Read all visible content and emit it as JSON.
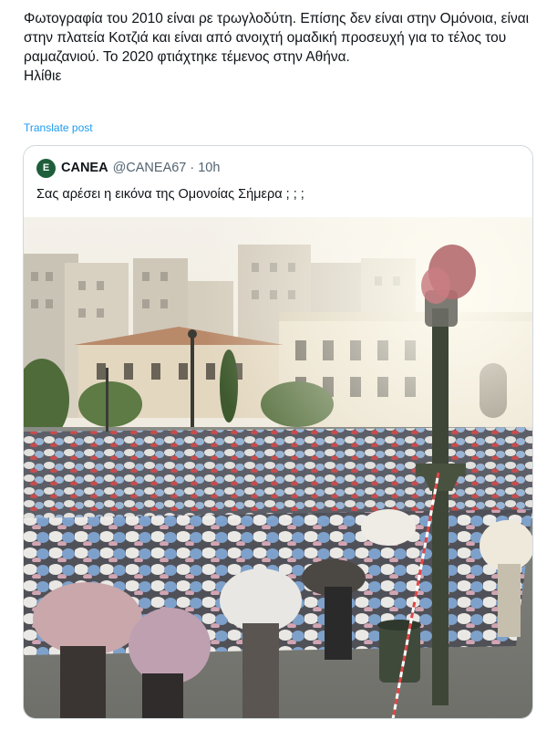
{
  "tweet": {
    "lines": [
      "Φωτογραφία του 2010 είναι ρε τρωγλοδύτη. Επίσης δεν είναι στην Ομόνοια, είναι στην πλατεία Κοτζιά και είναι από ανοιχτή ομαδική προσευχή για το τέλος του ραμαζανιού. Το 2020 φτιάχτηκε τέμενος στην Αθήνα.",
      "Ηλίθιε"
    ],
    "translate_label": "Translate post"
  },
  "quoted": {
    "avatar_letter": "E",
    "name": "CANEA",
    "handle": "@CANEA67",
    "separator": "·",
    "time": "10h",
    "text": "Σας αρέσει η εικόνα της Ομονοίας Σήμερα ; ; ;",
    "image_label": "photo-crowd-praying-in-square"
  },
  "colors": {
    "link": "#1d9bf0",
    "secondary": "#536471",
    "border": "#cfd9de",
    "avatar_bg": "#1f5e3b"
  }
}
